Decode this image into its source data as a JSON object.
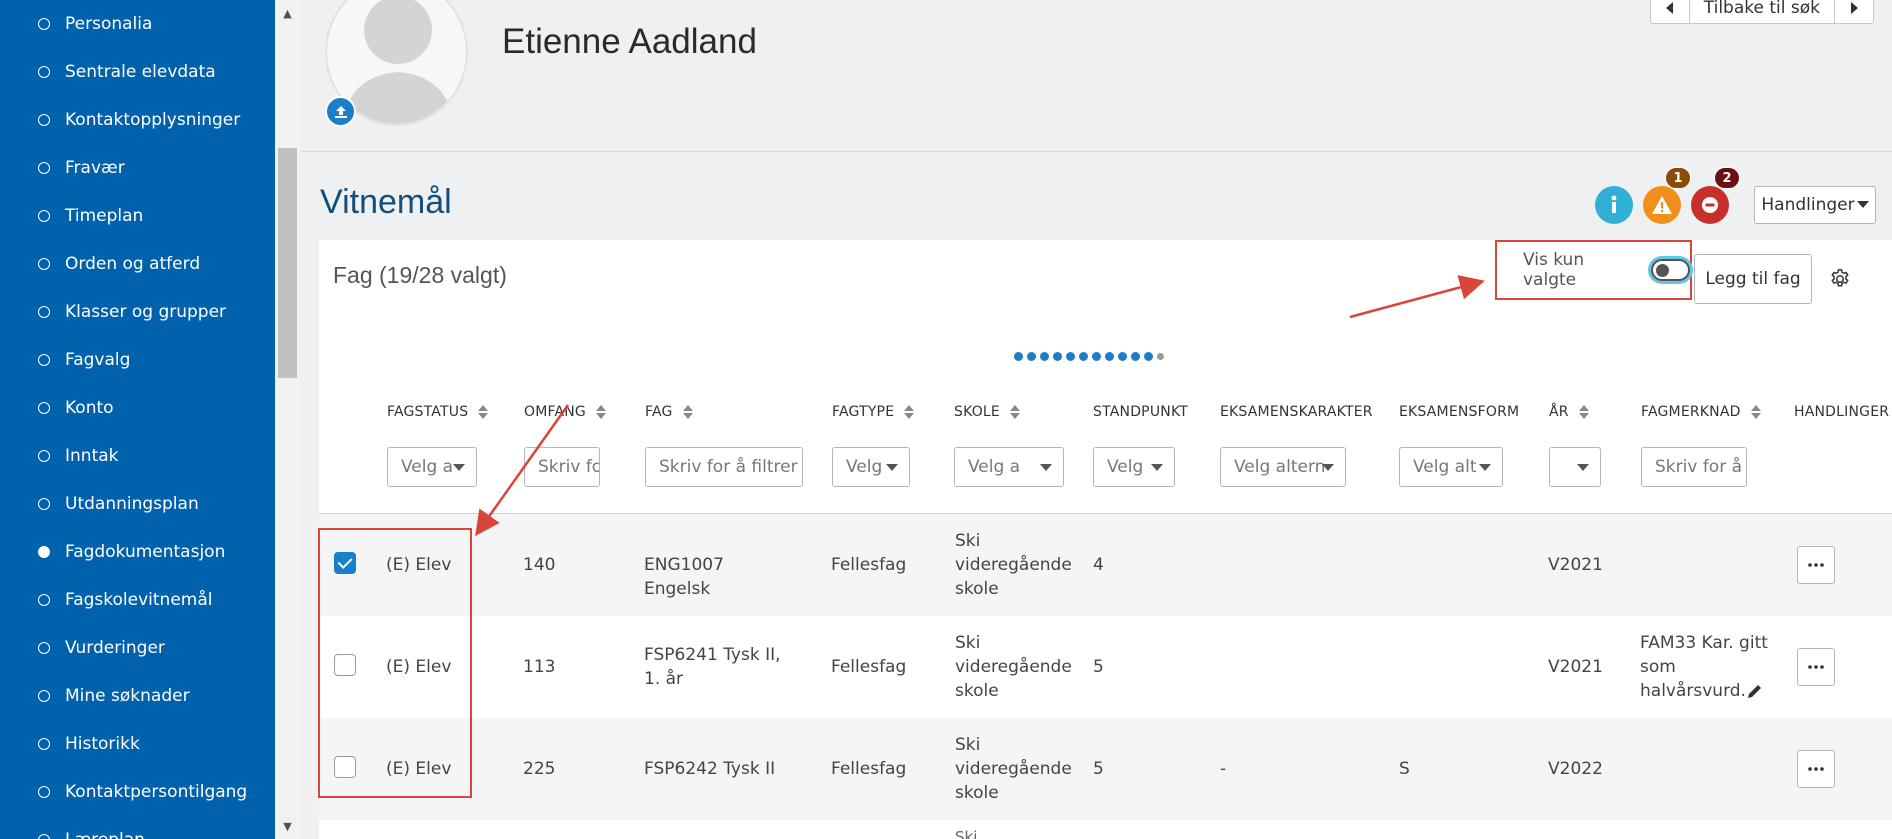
{
  "sidebar": {
    "items": [
      {
        "label": "Personalia",
        "active": false
      },
      {
        "label": "Sentrale elevdata",
        "active": false
      },
      {
        "label": "Kontaktopplysninger",
        "active": false
      },
      {
        "label": "Fravær",
        "active": false
      },
      {
        "label": "Timeplan",
        "active": false
      },
      {
        "label": "Orden og atferd",
        "active": false
      },
      {
        "label": "Klasser og grupper",
        "active": false
      },
      {
        "label": "Fagvalg",
        "active": false
      },
      {
        "label": "Konto",
        "active": false
      },
      {
        "label": "Inntak",
        "active": false
      },
      {
        "label": "Utdanningsplan",
        "active": false
      },
      {
        "label": "Fagdokumentasjon",
        "active": true
      },
      {
        "label": "Fagskolevitnemål",
        "active": false
      },
      {
        "label": "Vurderinger",
        "active": false
      },
      {
        "label": "Mine søknader",
        "active": false
      },
      {
        "label": "Historikk",
        "active": false
      },
      {
        "label": "Kontaktpersontilgang",
        "active": false
      },
      {
        "label": "Læreplan",
        "active": false
      }
    ]
  },
  "header": {
    "student_name": "Etienne Aadland",
    "back_to_search": "Tilbake til søk"
  },
  "page": {
    "title": "Vitnemål",
    "warning_count": "1",
    "error_count": "2",
    "actions_label": "Handlinger"
  },
  "card": {
    "title": "Fag (19/28 valgt)",
    "show_selected_label": "Vis kun valgte",
    "show_selected_on": false,
    "add_subject_label": "Legg til fag",
    "pager": {
      "pages": 12,
      "current": 11
    }
  },
  "table": {
    "columns": [
      {
        "label": "FAGSTATUS",
        "sortable": true,
        "filter": "Velg a"
      },
      {
        "label": "OMFANG",
        "sortable": true,
        "filter": "Skriv fo"
      },
      {
        "label": "FAG",
        "sortable": true,
        "filter": "Skriv for å filtrer"
      },
      {
        "label": "FAGTYPE",
        "sortable": true,
        "filter": "Velg"
      },
      {
        "label": "SKOLE",
        "sortable": true,
        "filter": "Velg a"
      },
      {
        "label": "STANDPUNKT",
        "sortable": false,
        "filter": "Velg"
      },
      {
        "label": "EKSAMENSKARAKTER",
        "sortable": false,
        "filter": "Velg altern"
      },
      {
        "label": "EKSAMENSFORM",
        "sortable": false,
        "filter": "Velg alt"
      },
      {
        "label": "ÅR",
        "sortable": true,
        "filter": ""
      },
      {
        "label": "FAGMERKNAD",
        "sortable": true,
        "filter": "Skriv for å fi"
      },
      {
        "label": "HANDLINGER",
        "sortable": false,
        "filter": ""
      }
    ],
    "rows": [
      {
        "checked": true,
        "fagstatus": "(E) Elev",
        "omfang": "140",
        "fag": "ENG1007 Engelsk",
        "fagtype": "Fellesfag",
        "skole": [
          "Ski",
          "videregående",
          "skole"
        ],
        "standpunkt": "4",
        "eksamenskarakter": "",
        "eksamensform": "",
        "aar": "V2021",
        "fagmerknad": []
      },
      {
        "checked": false,
        "fagstatus": "(E) Elev",
        "omfang": "113",
        "fag": "FSP6241 Tysk II, 1. år",
        "fagtype": "Fellesfag",
        "skole": [
          "Ski",
          "videregående",
          "skole"
        ],
        "standpunkt": "5",
        "eksamenskarakter": "",
        "eksamensform": "",
        "aar": "V2021",
        "fagmerknad": [
          "FAM33 Kar. gitt",
          "som",
          "halvårsvurd."
        ]
      },
      {
        "checked": false,
        "fagstatus": "(E) Elev",
        "omfang": "225",
        "fag": "FSP6242 Tysk II",
        "fagtype": "Fellesfag",
        "skole": [
          "Ski",
          "videregående",
          "skole"
        ],
        "standpunkt": "5",
        "eksamenskarakter": "-",
        "eksamensform": "S",
        "aar": "V2022",
        "fagmerknad": []
      }
    ],
    "next_row_partial": "Ski"
  },
  "colors": {
    "sidebar": "#0061ac",
    "accent": "#1b7ec8",
    "title": "#114f7d",
    "info": "#31b0d5",
    "warning": "#f0901a",
    "error": "#c9302c",
    "annotation": "#d9443b"
  },
  "icons": {
    "upload": "upload-icon",
    "info": "info-icon",
    "warning": "warning-icon",
    "error": "error-icon",
    "settings": "gear-icon",
    "edit": "pencil-icon",
    "more": "ellipsis-icon"
  }
}
